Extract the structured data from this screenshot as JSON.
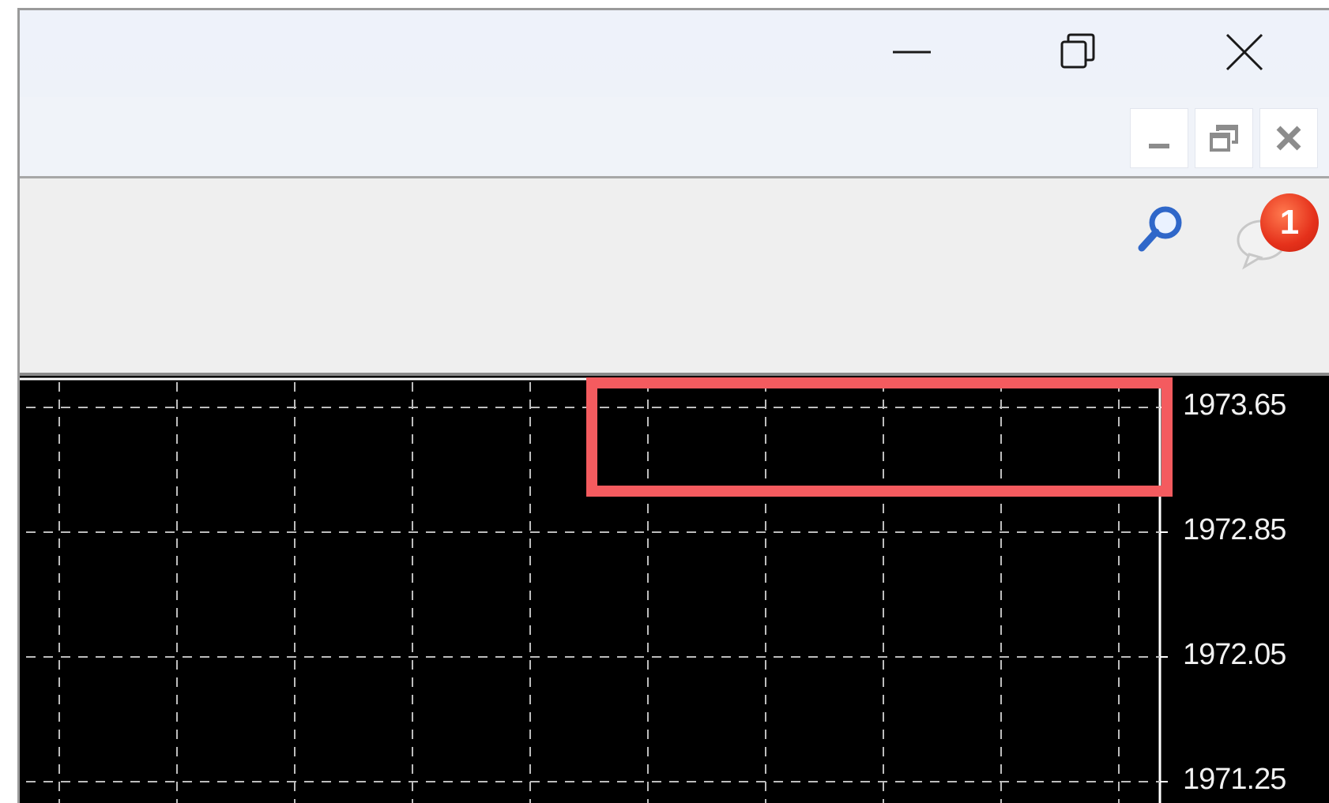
{
  "window": {
    "controls": {
      "minimize_icon": "minimize-icon",
      "restore_icon": "restore-icon",
      "close_icon": "close-icon"
    },
    "mdi_controls": {
      "minimize_icon": "minimize-icon",
      "restore_icon": "restore-icon",
      "close_icon": "close-icon"
    }
  },
  "toolbar": {
    "search_icon": "search-icon",
    "notifications_icon": "chat-bubble-icon",
    "notification_count": "1"
  },
  "chart": {
    "background": "#000000",
    "grid_color": "#bdbdbd",
    "grid_style": "dashed",
    "price_labels": [
      "1973.65",
      "1972.85",
      "1972.05",
      "1971.25"
    ]
  },
  "highlight": {
    "color": "#f45b5f"
  }
}
